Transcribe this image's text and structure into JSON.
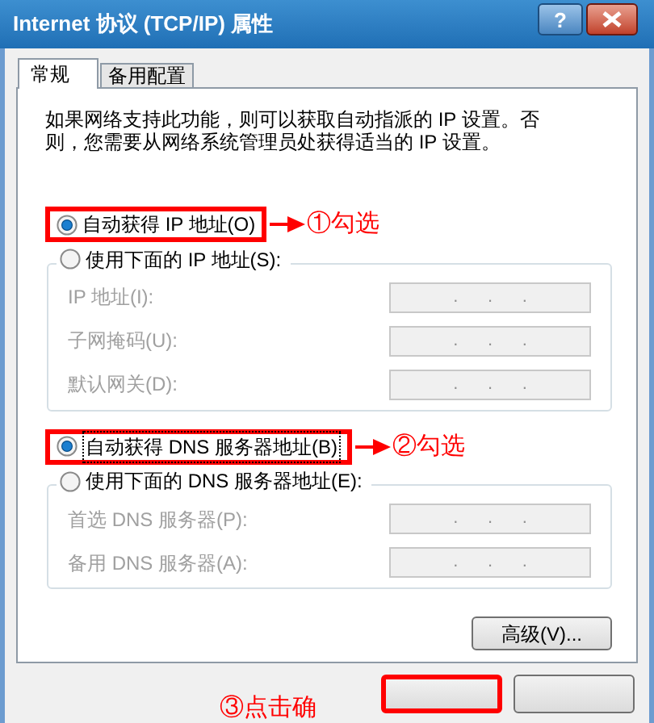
{
  "window": {
    "title": "Internet 协议 (TCP/IP) 属性",
    "help": "?"
  },
  "tabs": [
    {
      "label": "常规",
      "selected": true
    },
    {
      "label": "备用配置",
      "selected": false
    }
  ],
  "description": "如果网络支持此功能，则可以获取自动指派的 IP 设置。否则，您需要从网络系统管理员处获得适当的 IP 设置。",
  "ip_section": {
    "auto": {
      "label": "自动获得 IP 地址(O)",
      "selected": true,
      "annotation": "①勾选"
    },
    "manual": {
      "label": "使用下面的 IP 地址(S):",
      "selected": false
    },
    "fields": [
      {
        "label": "IP 地址(I):",
        "value": ".      .      .",
        "disabled": true
      },
      {
        "label": "子网掩码(U):",
        "value": ".      .      .",
        "disabled": true
      },
      {
        "label": "默认网关(D):",
        "value": ".      .      .",
        "disabled": true
      }
    ]
  },
  "dns_section": {
    "auto": {
      "label": "自动获得 DNS 服务器地址(B)",
      "selected": true,
      "annotation": "②勾选"
    },
    "manual": {
      "label": "使用下面的 DNS 服务器地址(E):",
      "selected": false
    },
    "fields": [
      {
        "label": "首选 DNS 服务器(P):",
        "value": ".      .      .",
        "disabled": true
      },
      {
        "label": "备用 DNS 服务器(A):",
        "value": ".      .      .",
        "disabled": true
      }
    ]
  },
  "advanced_button": "高级(V)...",
  "footer": {
    "annotation": "③点击确",
    "buttons": [
      {
        "highlighted": true
      },
      {
        "highlighted": false
      }
    ]
  }
}
